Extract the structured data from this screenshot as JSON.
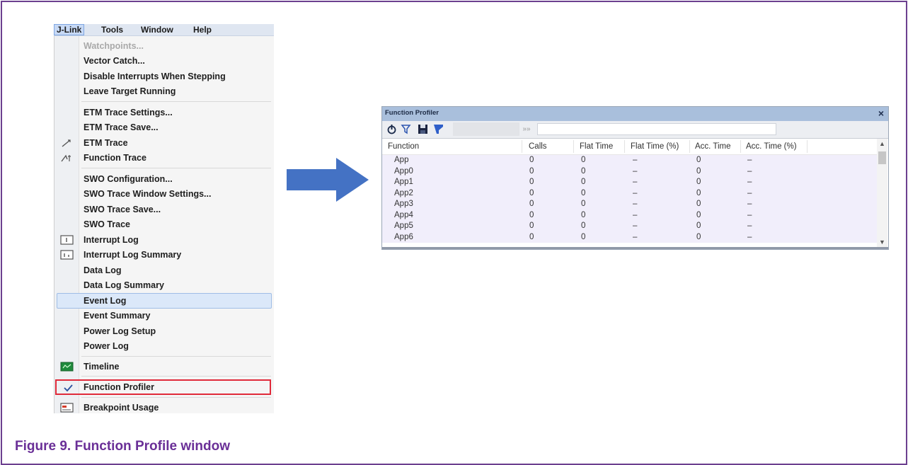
{
  "menubar": {
    "items": [
      "J-Link",
      "Tools",
      "Window",
      "Help"
    ]
  },
  "menu": {
    "items": [
      "Watchpoints...",
      "Vector Catch...",
      "Disable Interrupts When Stepping",
      "Leave Target Running",
      "ETM Trace Settings...",
      "ETM Trace Save...",
      "ETM Trace",
      "Function Trace",
      "SWO Configuration...",
      "SWO Trace Window Settings...",
      "SWO Trace Save...",
      "SWO Trace",
      "Interrupt Log",
      "Interrupt Log Summary",
      "Data Log",
      "Data Log Summary",
      "Event Log",
      "Event Summary",
      "Power Log Setup",
      "Power Log",
      "Timeline",
      "Function Profiler",
      "Breakpoint Usage"
    ],
    "disabled_item": "Watchpoints...",
    "highlighted_item": "Event Log",
    "selected_item": "Function Profiler"
  },
  "profiler": {
    "title": "Function Profiler",
    "close_glyph": "×",
    "fast_forward_glyph": "»»",
    "columns": [
      "Function",
      "Calls",
      "Flat Time",
      "Flat Time (%)",
      "Acc. Time",
      "Acc. Time (%)"
    ],
    "rows": [
      [
        "App",
        "0",
        "0",
        "–",
        "0",
        "–"
      ],
      [
        "App0",
        "0",
        "0",
        "–",
        "0",
        "–"
      ],
      [
        "App1",
        "0",
        "0",
        "–",
        "0",
        "–"
      ],
      [
        "App2",
        "0",
        "0",
        "–",
        "0",
        "–"
      ],
      [
        "App3",
        "0",
        "0",
        "–",
        "0",
        "–"
      ],
      [
        "App4",
        "0",
        "0",
        "–",
        "0",
        "–"
      ],
      [
        "App5",
        "0",
        "0",
        "–",
        "0",
        "–"
      ],
      [
        "App6",
        "0",
        "0",
        "–",
        "0",
        "–"
      ]
    ]
  },
  "caption": "Figure 9.  Function Profile window",
  "colors": {
    "caption": "#6a2f97",
    "frame": "#6c3f8f",
    "arrow": "#4472c4",
    "selection_outline": "#e02a3a"
  }
}
